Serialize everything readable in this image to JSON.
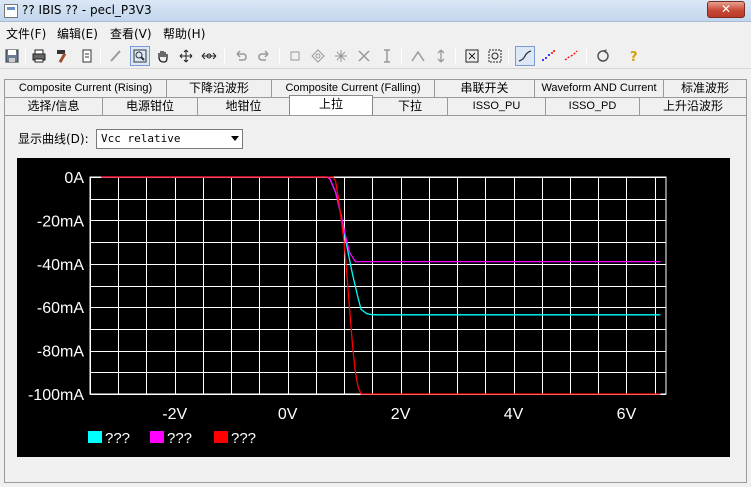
{
  "window": {
    "title": "?? IBIS ?? - pecl_P3V3",
    "close_label": "✕"
  },
  "menu": [
    "文件(F)",
    "编辑(E)",
    "查看(V)",
    "帮助(H)"
  ],
  "toolbar": {
    "icons": [
      "save-icon",
      "print-icon",
      "hammer-icon",
      "document-icon",
      "pencil-icon",
      "zoom-icon",
      "hand-icon",
      "move-icon",
      "expand-icon",
      "undo-icon",
      "redo-icon",
      "rectangle-icon",
      "diamond-icon",
      "star-icon",
      "cross-icon",
      "ibeam-icon",
      "peak-icon",
      "vertical-arrows-icon",
      "fit-icon",
      "zoom-region-icon",
      "curve-icon",
      "dots-icon",
      "dotted-line-icon",
      "refresh-icon",
      "help-icon"
    ]
  },
  "tabs": {
    "row1": [
      "Composite Current (Rising)",
      "下降沿波形",
      "Composite Current (Falling)",
      "串联开关",
      "Waveform AND Current",
      "标准波形"
    ],
    "row2": [
      "选择/信息",
      "电源钳位",
      "地钳位",
      "上拉",
      "下拉",
      "ISSO_PU",
      "ISSO_PD",
      "上升沿波形"
    ],
    "active": "上拉"
  },
  "display_curve": {
    "label": "显示曲线(D):",
    "selected": "Vcc relative"
  },
  "colors": {
    "background": "#000000",
    "grid": "#ffffff",
    "series": [
      "#00ffff",
      "#ff00ff",
      "#ff0000"
    ]
  },
  "chart_data": {
    "type": "line",
    "xlim": [
      -3.5,
      6.7
    ],
    "ylim": [
      -100,
      0
    ],
    "xticks": [
      -2,
      0,
      2,
      4,
      6
    ],
    "xtick_labels": [
      "-2V",
      "0V",
      "2V",
      "4V",
      "6V"
    ],
    "yticks": [
      0,
      -20,
      -40,
      -60,
      -80,
      -100
    ],
    "ytick_labels": [
      "0A",
      "-20mA",
      "-40mA",
      "-60mA",
      "-80mA",
      "-100mA"
    ],
    "grid": true,
    "legend_placement": "bottom-left",
    "series": [
      {
        "name": "???",
        "color": "#00ffff",
        "x": [
          -3.3,
          0.7,
          0.75,
          0.85,
          0.95,
          1.05,
          1.15,
          1.25,
          1.3,
          1.4,
          1.5,
          6.6
        ],
        "y": [
          0,
          0,
          -1,
          -7,
          -18,
          -32,
          -45,
          -56,
          -61,
          -63,
          -63.5,
          -63.5
        ]
      },
      {
        "name": "???",
        "color": "#ff00ff",
        "x": [
          -3.3,
          0.7,
          0.75,
          0.85,
          0.95,
          1.05,
          1.1,
          1.2,
          1.4,
          6.6
        ],
        "y": [
          0,
          0,
          -1,
          -7,
          -18,
          -30,
          -35,
          -39,
          -39,
          -39
        ]
      },
      {
        "name": "???",
        "color": "#ff0000",
        "x": [
          -3.3,
          0.8,
          0.85,
          0.9,
          1.0,
          1.05,
          1.1,
          1.15,
          1.2,
          1.25,
          1.3,
          6.6
        ],
        "y": [
          0,
          0,
          -2,
          -10,
          -30,
          -45,
          -62,
          -78,
          -90,
          -97,
          -100,
          -100
        ]
      }
    ]
  }
}
